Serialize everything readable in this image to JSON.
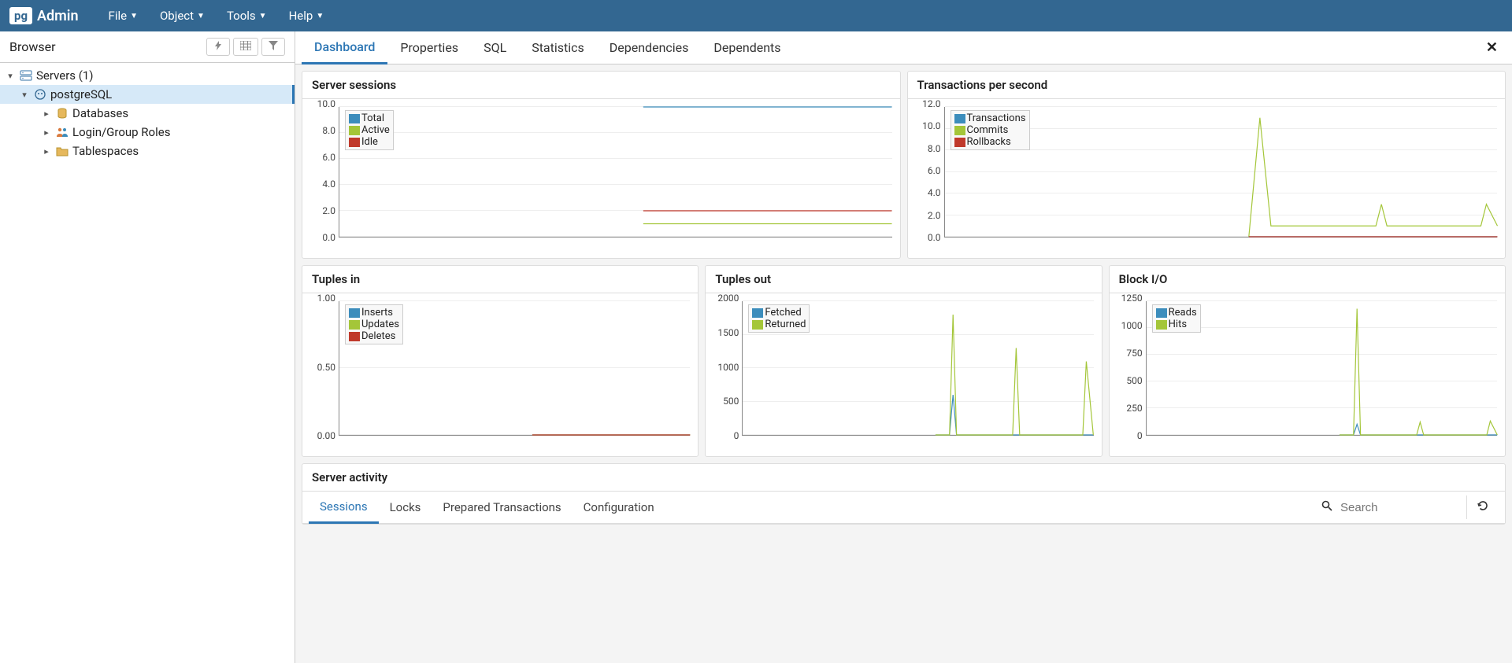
{
  "topbar": {
    "logo_pg": "pg",
    "logo_admin": "Admin",
    "menu": [
      "File",
      "Object",
      "Tools",
      "Help"
    ]
  },
  "sidebar": {
    "title": "Browser",
    "tree": {
      "servers": "Servers (1)",
      "server_name": "postgreSQL",
      "items": [
        "Databases",
        "Login/Group Roles",
        "Tablespaces"
      ]
    }
  },
  "tabs": [
    "Dashboard",
    "Properties",
    "SQL",
    "Statistics",
    "Dependencies",
    "Dependents"
  ],
  "charts": {
    "sessions": {
      "title": "Server sessions",
      "legend": [
        "Total",
        "Active",
        "Idle"
      ]
    },
    "tps": {
      "title": "Transactions per second",
      "legend": [
        "Transactions",
        "Commits",
        "Rollbacks"
      ]
    },
    "tin": {
      "title": "Tuples in",
      "legend": [
        "Inserts",
        "Updates",
        "Deletes"
      ]
    },
    "tout": {
      "title": "Tuples out",
      "legend": [
        "Fetched",
        "Returned"
      ]
    },
    "bio": {
      "title": "Block I/O",
      "legend": [
        "Reads",
        "Hits"
      ]
    }
  },
  "activity": {
    "title": "Server activity",
    "tabs": [
      "Sessions",
      "Locks",
      "Prepared Transactions",
      "Configuration"
    ],
    "search_placeholder": "Search"
  },
  "chart_data": [
    {
      "id": "sessions",
      "type": "line",
      "title": "Server sessions",
      "ylim": [
        0,
        10
      ],
      "yticks": [
        0.0,
        2.0,
        4.0,
        6.0,
        8.0,
        10.0
      ],
      "series": [
        {
          "name": "Total",
          "color": "#3c8dbc",
          "points": [
            [
              0.55,
              10
            ],
            [
              1,
              10
            ]
          ]
        },
        {
          "name": "Active",
          "color": "#a4c639",
          "points": [
            [
              0.55,
              1
            ],
            [
              1,
              1
            ]
          ]
        },
        {
          "name": "Idle",
          "color": "#c0392b",
          "points": [
            [
              0.55,
              2
            ],
            [
              1,
              2
            ]
          ]
        }
      ]
    },
    {
      "id": "tps",
      "type": "line",
      "title": "Transactions per second",
      "ylim": [
        0,
        12
      ],
      "yticks": [
        0.0,
        2.0,
        4.0,
        6.0,
        8.0,
        10.0,
        12.0
      ],
      "series": [
        {
          "name": "Transactions",
          "color": "#3c8dbc",
          "points": [
            [
              0.55,
              0
            ],
            [
              1,
              0
            ]
          ]
        },
        {
          "name": "Commits",
          "color": "#a4c639",
          "points": [
            [
              0.55,
              0
            ],
            [
              0.57,
              11
            ],
            [
              0.59,
              1
            ],
            [
              0.78,
              1
            ],
            [
              0.79,
              3
            ],
            [
              0.8,
              1
            ],
            [
              0.97,
              1
            ],
            [
              0.98,
              3
            ],
            [
              1,
              1
            ]
          ]
        },
        {
          "name": "Rollbacks",
          "color": "#c0392b",
          "points": [
            [
              0.55,
              0
            ],
            [
              1,
              0
            ]
          ]
        }
      ]
    },
    {
      "id": "tin",
      "type": "line",
      "title": "Tuples in",
      "ylim": [
        0,
        1.0
      ],
      "yticks": [
        0.0,
        0.5,
        1.0
      ],
      "decimals": 2,
      "series": [
        {
          "name": "Inserts",
          "color": "#3c8dbc",
          "points": [
            [
              0.55,
              0
            ],
            [
              1,
              0
            ]
          ]
        },
        {
          "name": "Updates",
          "color": "#a4c639",
          "points": [
            [
              0.55,
              0
            ],
            [
              1,
              0
            ]
          ]
        },
        {
          "name": "Deletes",
          "color": "#c0392b",
          "points": [
            [
              0.55,
              0
            ],
            [
              1,
              0
            ]
          ]
        }
      ]
    },
    {
      "id": "tout",
      "type": "line",
      "title": "Tuples out",
      "ylim": [
        0,
        2000
      ],
      "yticks": [
        0,
        500,
        1000,
        1500,
        2000
      ],
      "series": [
        {
          "name": "Fetched",
          "color": "#3c8dbc",
          "points": [
            [
              0.55,
              0
            ],
            [
              0.59,
              0
            ],
            [
              0.6,
              600
            ],
            [
              0.61,
              0
            ],
            [
              1,
              0
            ]
          ]
        },
        {
          "name": "Returned",
          "color": "#a4c639",
          "points": [
            [
              0.55,
              0
            ],
            [
              0.59,
              0
            ],
            [
              0.6,
              1800
            ],
            [
              0.61,
              0
            ],
            [
              0.77,
              0
            ],
            [
              0.78,
              1300
            ],
            [
              0.79,
              0
            ],
            [
              0.97,
              0
            ],
            [
              0.98,
              1100
            ],
            [
              1,
              0
            ]
          ]
        }
      ]
    },
    {
      "id": "bio",
      "type": "line",
      "title": "Block I/O",
      "ylim": [
        0,
        1250
      ],
      "yticks": [
        0,
        250,
        500,
        750,
        1000,
        1250
      ],
      "series": [
        {
          "name": "Reads",
          "color": "#3c8dbc",
          "points": [
            [
              0.55,
              0
            ],
            [
              0.59,
              0
            ],
            [
              0.6,
              100
            ],
            [
              0.61,
              0
            ],
            [
              1,
              0
            ]
          ]
        },
        {
          "name": "Hits",
          "color": "#a4c639",
          "points": [
            [
              0.55,
              0
            ],
            [
              0.59,
              0
            ],
            [
              0.6,
              1180
            ],
            [
              0.61,
              0
            ],
            [
              0.77,
              0
            ],
            [
              0.78,
              120
            ],
            [
              0.79,
              0
            ],
            [
              0.97,
              0
            ],
            [
              0.98,
              130
            ],
            [
              1,
              0
            ]
          ]
        }
      ]
    }
  ]
}
